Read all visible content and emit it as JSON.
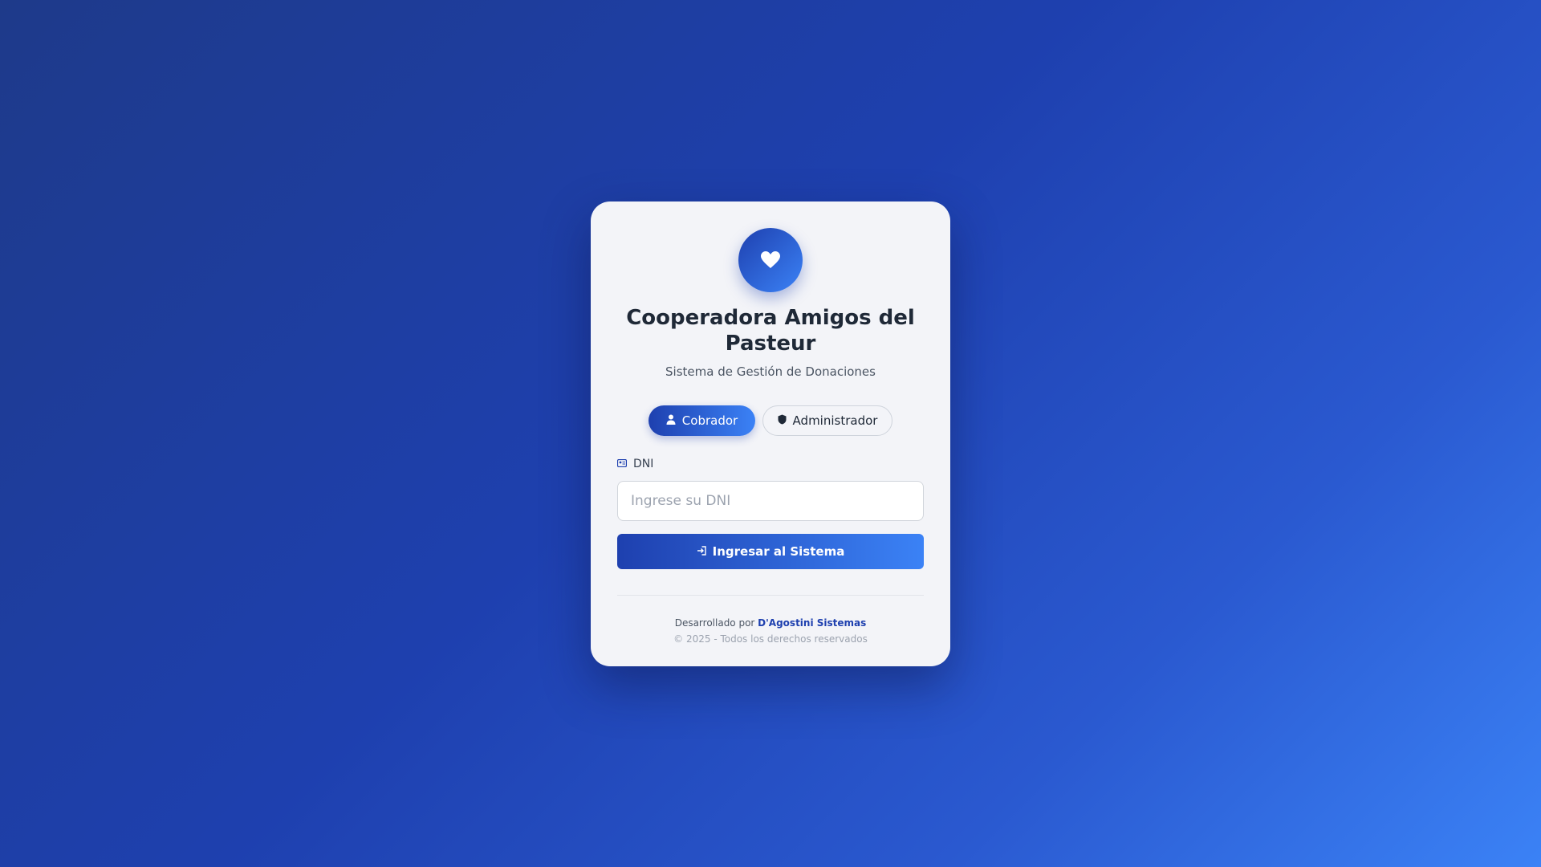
{
  "logo": {
    "icon": "heart-hands-icon",
    "color": "#ffffff"
  },
  "header": {
    "title": "Cooperadora Amigos del Pasteur",
    "subtitle": "Sistema de Gestión de Donaciones"
  },
  "roles": {
    "selected": "Cobrador",
    "items": [
      {
        "label": "Cobrador",
        "icon": "user-icon"
      },
      {
        "label": "Administrador",
        "icon": "shield-icon"
      }
    ]
  },
  "form": {
    "dni_label": "DNI",
    "dni_icon": "id-card-icon",
    "dni_value": "",
    "dni_placeholder": "Ingrese su DNI",
    "submit_label": "Ingresar al Sistema",
    "submit_icon": "sign-in-icon"
  },
  "footer": {
    "developed_by": "Desarrollado por",
    "developer": "D'Agostini Sistemas",
    "copyright": "© 2025 - Todos los derechos reservados"
  },
  "colors": {
    "accent": "#1e40af",
    "accent_light": "#3b82f6",
    "card_bg": "#f3f4f8"
  }
}
